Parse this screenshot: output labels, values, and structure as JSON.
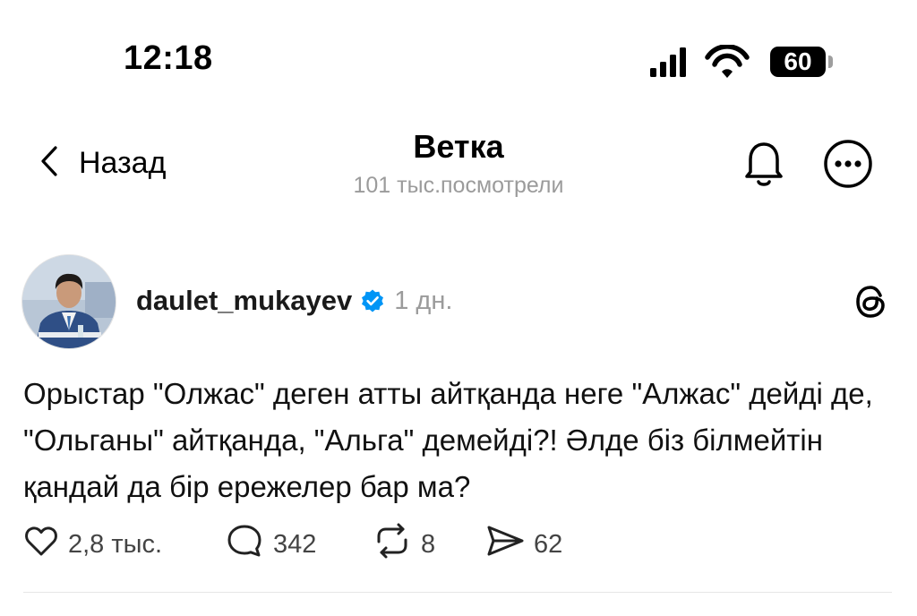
{
  "status_bar": {
    "time": "12:18",
    "battery": "60"
  },
  "header": {
    "back_label": "Назад",
    "title": "Ветка",
    "subtitle": "101 тыс.посмотрели"
  },
  "post": {
    "username": "daulet_mukayev",
    "time_ago": "1 дн.",
    "text": "Орыстар \"Олжас\" деген атты айтқанда неге \"Алжас\" дейді де, \"Ольганы\" айтқанда, \"Альга\" демейді?! Әлде біз білмейтін қандай да бір ережелер бар ма?",
    "verified": true,
    "actions": {
      "likes": "2,8 тыс.",
      "replies": "342",
      "reposts": "8",
      "shares": "62"
    }
  },
  "icons": {
    "back": "chevron-left-icon",
    "bell": "bell-icon",
    "more": "more-horizontal-icon",
    "threads": "threads-logo-icon",
    "verified": "verified-badge-icon",
    "like": "heart-icon",
    "reply": "comment-icon",
    "repost": "repost-icon",
    "share": "send-icon"
  },
  "colors": {
    "verified": "#0095f6",
    "secondary_text": "#9b9b9b",
    "divider": "#e6e6e6"
  }
}
